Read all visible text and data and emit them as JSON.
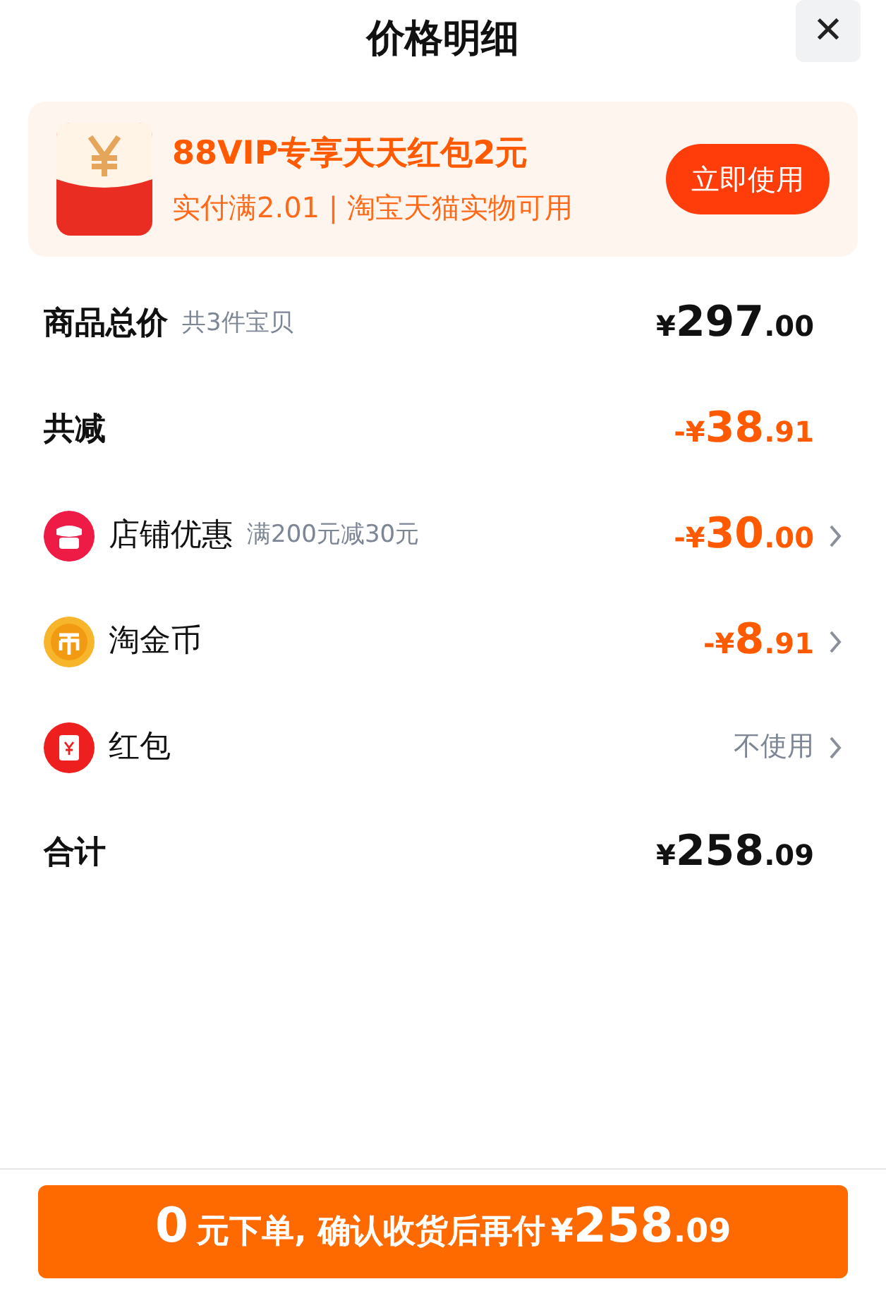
{
  "title": "价格明细",
  "close": {
    "label": "✕"
  },
  "promo": {
    "headline": "88VIP专享天天红包2元",
    "subline": "实付满2.01 | 淘宝天猫实物可用",
    "action": "立即使用"
  },
  "rows": [
    {
      "kind": "subtotal",
      "label": "商品总价",
      "note": "共3件宝贝",
      "sign": "",
      "symbol": "¥",
      "whole": "297",
      "fraction": ".00"
    },
    {
      "kind": "discount_total",
      "label": "共减",
      "sign": "-",
      "symbol": "¥",
      "whole": "38",
      "fraction": ".91"
    },
    {
      "kind": "store_discount",
      "label": "店铺优惠",
      "note": "满200元减30元",
      "sign": "-",
      "symbol": "¥",
      "whole": "30",
      "fraction": ".00"
    },
    {
      "kind": "coin_discount",
      "label": "淘金币",
      "sign": "-",
      "symbol": "¥",
      "whole": "8",
      "fraction": ".91"
    },
    {
      "kind": "packet_option",
      "label": "红包",
      "value": "不使用"
    },
    {
      "kind": "total",
      "label": "合计",
      "sign": "",
      "symbol": "¥",
      "whole": "258",
      "fraction": ".09"
    }
  ],
  "submit": {
    "lead": "0",
    "middle": "元下单, 确认收货后再付",
    "symbol": "¥",
    "whole": "258",
    "fraction": ".09"
  }
}
